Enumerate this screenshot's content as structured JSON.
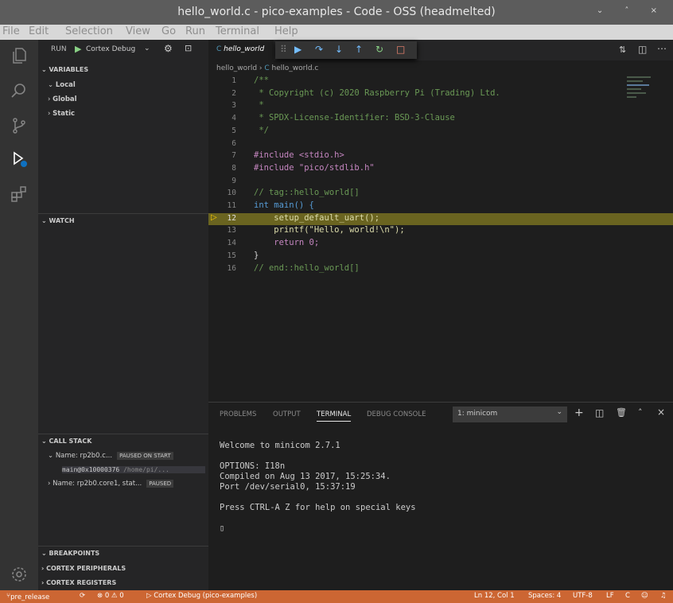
{
  "window": {
    "title": "hello_world.c - pico-examples - Code - OSS (headmelted)",
    "controls": "⌄ ˄ ×"
  },
  "menu": [
    "File",
    "Edit",
    "Selection",
    "View",
    "Go",
    "Run",
    "Terminal",
    "Help"
  ],
  "run_panel": {
    "label": "RUN",
    "config": "Cortex Debug",
    "sections": {
      "variables": "VARIABLES",
      "watch": "WATCH",
      "call_stack": "CALL STACK",
      "breakpoints": "BREAKPOINTS",
      "cortex_peripherals": "CORTEX PERIPHERALS",
      "cortex_registers": "CORTEX REGISTERS"
    },
    "variables": [
      "Local",
      "Global",
      "Static"
    ],
    "call_stack": [
      {
        "name": "Name: rp2b0.c...",
        "status": "PAUSED ON START"
      },
      {
        "frame": "main@0x10000376",
        "path": "/home/pi/..."
      },
      {
        "name": "Name: rp2b0.core1, stat...",
        "status": "PAUSED"
      }
    ]
  },
  "editor": {
    "tab": "hello_world",
    "breadcrumb": [
      "hello_world",
      "hello_world.c"
    ],
    "current_line": 12,
    "lines": [
      {
        "n": "1",
        "t": "/**",
        "c": "com"
      },
      {
        "n": "2",
        "t": " * Copyright (c) 2020 Raspberry Pi (Trading) Ltd.",
        "c": "com"
      },
      {
        "n": "3",
        "t": " *",
        "c": "com"
      },
      {
        "n": "4",
        "t": " * SPDX-License-Identifier: BSD-3-Clause",
        "c": "com"
      },
      {
        "n": "5",
        "t": " */",
        "c": "com"
      },
      {
        "n": "6",
        "t": "",
        "c": "def"
      },
      {
        "n": "7",
        "t": "#include <stdio.h>",
        "c": "pre"
      },
      {
        "n": "8",
        "t": "#include \"pico/stdlib.h\"",
        "c": "pre"
      },
      {
        "n": "9",
        "t": "",
        "c": "def"
      },
      {
        "n": "10",
        "t": "// tag::hello_world[]",
        "c": "com"
      },
      {
        "n": "11",
        "t": "int main() {",
        "c": "kw"
      },
      {
        "n": "12",
        "t": "    setup_default_uart();",
        "c": "fn"
      },
      {
        "n": "13",
        "t": "    printf(\"Hello, world!\\n\");",
        "c": "fn"
      },
      {
        "n": "14",
        "t": "    return 0;",
        "c": "pre"
      },
      {
        "n": "15",
        "t": "}",
        "c": "def"
      },
      {
        "n": "16",
        "t": "// end::hello_world[]",
        "c": "com"
      }
    ]
  },
  "panel": {
    "tabs": [
      "PROBLEMS",
      "OUTPUT",
      "TERMINAL",
      "DEBUG CONSOLE"
    ],
    "active_tab": "TERMINAL",
    "terminal_select": "1: minicom",
    "terminal_output": "Welcome to minicom 2.7.1\n\nOPTIONS: I18n\nCompiled on Aug 13 2017, 15:25:34.\nPort /dev/serial0, 15:37:19\n\nPress CTRL-A Z for help on special keys\n\n▯"
  },
  "statusbar": {
    "branch": "pre_release",
    "problems": "⊗ 0 ⚠ 0",
    "debug": "▷ Cortex Debug (pico-examples)",
    "position": "Ln 12, Col 1",
    "spaces": "Spaces: 4",
    "encoding": "UTF-8",
    "eol": "LF",
    "language": "C"
  }
}
